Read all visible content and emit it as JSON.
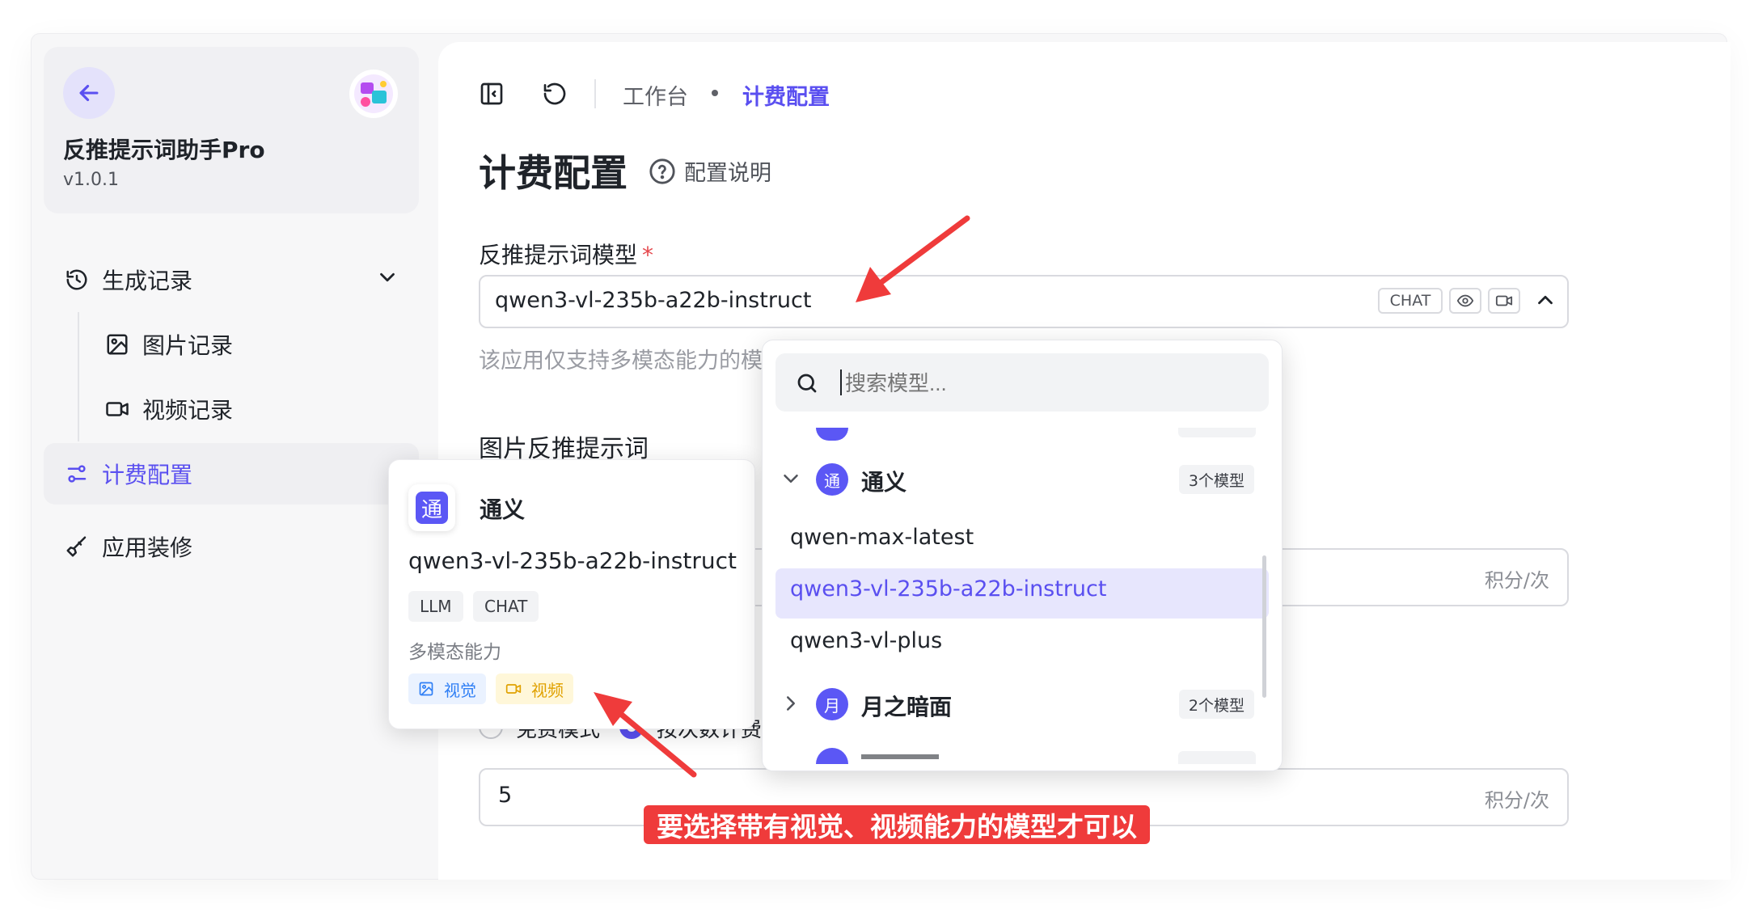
{
  "app": {
    "name": "反推提示词助手Pro",
    "version": "v1.0.1"
  },
  "sidebar": {
    "items": [
      {
        "label": "生成记录"
      },
      {
        "label": "图片记录"
      },
      {
        "label": "视频记录"
      },
      {
        "label": "计费配置"
      },
      {
        "label": "应用装修"
      }
    ]
  },
  "header": {
    "crumb_home": "工作台",
    "crumb_current": "计费配置"
  },
  "page": {
    "title": "计费配置",
    "help": "配置说明"
  },
  "model_field": {
    "label": "反推提示词模型",
    "required_mark": "*",
    "value": "qwen3-vl-235b-a22b-instruct",
    "tag": "CHAT",
    "hint": "该应用仅支持多模态能力的模"
  },
  "section": {
    "title": "图片反推提示词"
  },
  "inputs": {
    "unit": "积分/次",
    "value2": "5"
  },
  "radio": {
    "free_label": "免费模式",
    "count_label": "按次数计费"
  },
  "hover_card": {
    "provider_glyph": "通",
    "provider": "通义",
    "model": "qwen3-vl-235b-a22b-instruct",
    "tags": [
      "LLM",
      "CHAT"
    ],
    "ability_title": "多模态能力",
    "cap_vision": "视觉",
    "cap_video": "视频"
  },
  "dropdown": {
    "search_placeholder": "搜索模型...",
    "groups": [
      {
        "glyph": "通",
        "name": "通义",
        "count": "3个模型"
      },
      {
        "glyph": "月",
        "name": "月之暗面",
        "count": "2个模型"
      }
    ],
    "options": [
      "qwen-max-latest",
      "qwen3-vl-235b-a22b-instruct",
      "qwen3-vl-plus"
    ]
  },
  "annotation": {
    "text": "要选择带有视觉、视频能力的模型才可以"
  },
  "colors": {
    "accent": "#5a4ff0",
    "annotation_red": "#ef3b3b",
    "vision_blue": "#2f7ff5",
    "video_amber": "#e0a100"
  }
}
